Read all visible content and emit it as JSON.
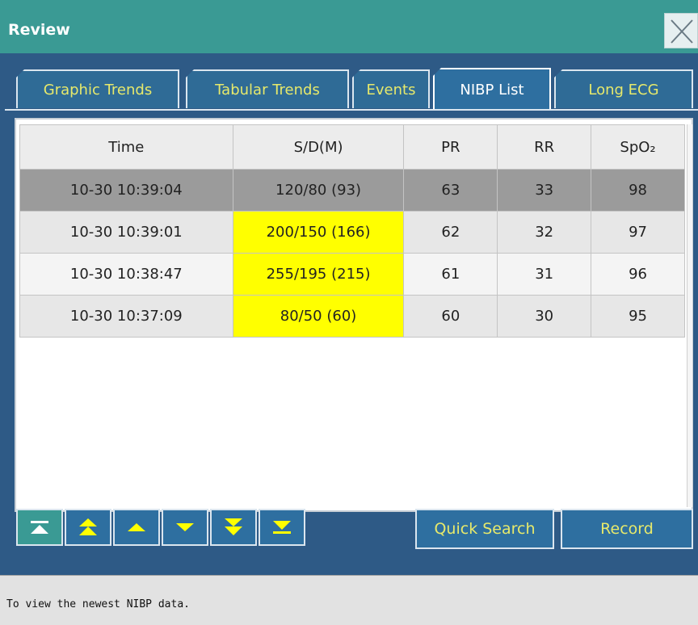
{
  "window": {
    "title": "Review"
  },
  "tabs": [
    {
      "label": "Graphic Trends",
      "active": false
    },
    {
      "label": "Tabular Trends",
      "active": false
    },
    {
      "label": "Events",
      "active": false
    },
    {
      "label": "NIBP List",
      "active": true
    },
    {
      "label": "Long ECG",
      "active": false
    }
  ],
  "table": {
    "headers": [
      "Time",
      "S/D(M)",
      "PR",
      "RR",
      "SpO₂"
    ],
    "rows": [
      {
        "time": "10-30 10:39:04",
        "sdm": "120/80 (93)",
        "pr": "63",
        "rr": "33",
        "spo2": "98",
        "selected": true,
        "alarm": false
      },
      {
        "time": "10-30 10:39:01",
        "sdm": "200/150 (166)",
        "pr": "62",
        "rr": "32",
        "spo2": "97",
        "selected": false,
        "alarm": true
      },
      {
        "time": "10-30 10:38:47",
        "sdm": "255/195 (215)",
        "pr": "61",
        "rr": "31",
        "spo2": "96",
        "selected": false,
        "alarm": true
      },
      {
        "time": "10-30 10:37:09",
        "sdm": "80/50 (60)",
        "pr": "60",
        "rr": "30",
        "spo2": "95",
        "selected": false,
        "alarm": true
      }
    ]
  },
  "nav_buttons": [
    {
      "icon": "jump-to-top-icon",
      "active": true
    },
    {
      "icon": "page-up-icon",
      "active": false
    },
    {
      "icon": "row-up-icon",
      "active": false
    },
    {
      "icon": "row-down-icon",
      "active": false
    },
    {
      "icon": "page-down-icon",
      "active": false
    },
    {
      "icon": "jump-to-bottom-icon",
      "active": false
    }
  ],
  "actions": {
    "quick_search": "Quick Search",
    "record": "Record"
  },
  "status": {
    "message": "To view the newest NIBP data."
  },
  "colors": {
    "title_bar": "#3a9a94",
    "background": "#2e5a86",
    "tab_text": "#e7e96b",
    "alarm": "#ffff00",
    "selected_row": "#9b9b9b"
  }
}
